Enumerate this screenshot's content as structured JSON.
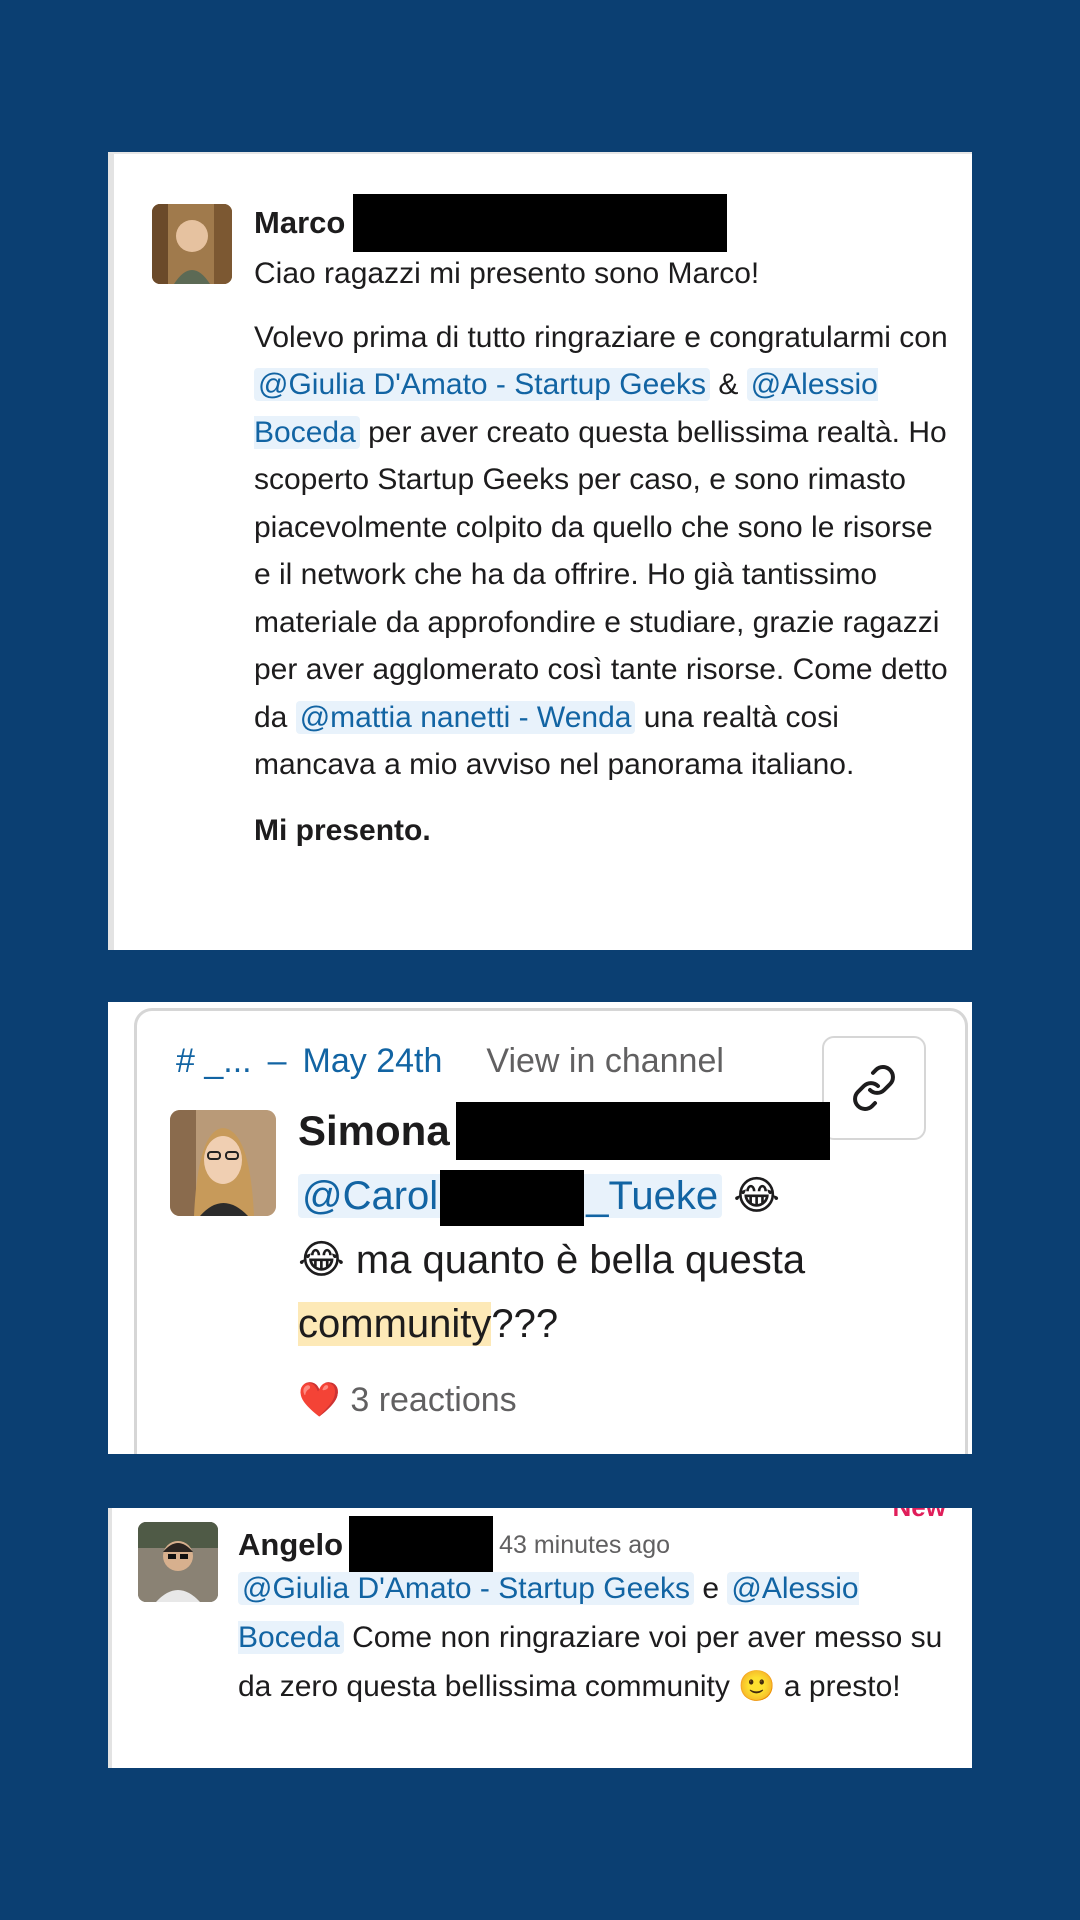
{
  "card1": {
    "author": "Marco",
    "intro": "Ciao ragazzi mi presento sono Marco!",
    "p1_a": "Volevo prima di tutto ringraziare e congratularmi con ",
    "mention1": "@Giulia D'Amato - Startup Geeks",
    "p1_b": " & ",
    "mention2": "@Alessio Boceda",
    "p1_c": " per aver creato questa bellissima realtà. Ho scoperto Startup Geeks per caso, e sono rimasto piacevolmente colpito da quello che sono le risorse e il network che ha da offrire. Ho già tantissimo materiale da approfondire e studiare, grazie ragazzi per aver agglomerato così tante risorse. Come detto da ",
    "mention3": "@mattia nanetti - Wenda",
    "p1_d": " una realtà cosi mancava a mio avviso nel panorama italiano.",
    "signoff": "Mi presento."
  },
  "card2": {
    "channel": "# _...",
    "dash": "–",
    "date": "May 24th",
    "view_in_channel": "View in channel",
    "author": "Simona",
    "mention_prefix": "@Carol",
    "mention_suffix": "_Tueke",
    "emoji": "😂",
    "text_a": " ma quanto è bella questa ",
    "highlight": "community",
    "text_b": "???",
    "reaction_emoji": "❤️",
    "reactions": "3 reactions"
  },
  "card3": {
    "new_label": "New",
    "author": "Angelo",
    "time": "43 minutes ago",
    "mention1": "@Giulia D'Amato - Startup Geeks",
    "conj": " e ",
    "mention2": "@Alessio Boceda",
    "text_a": " Come non ringraziare voi per aver messo su da zero questa bellissima community ",
    "emoji": "🙂",
    "text_b": " a presto!"
  }
}
